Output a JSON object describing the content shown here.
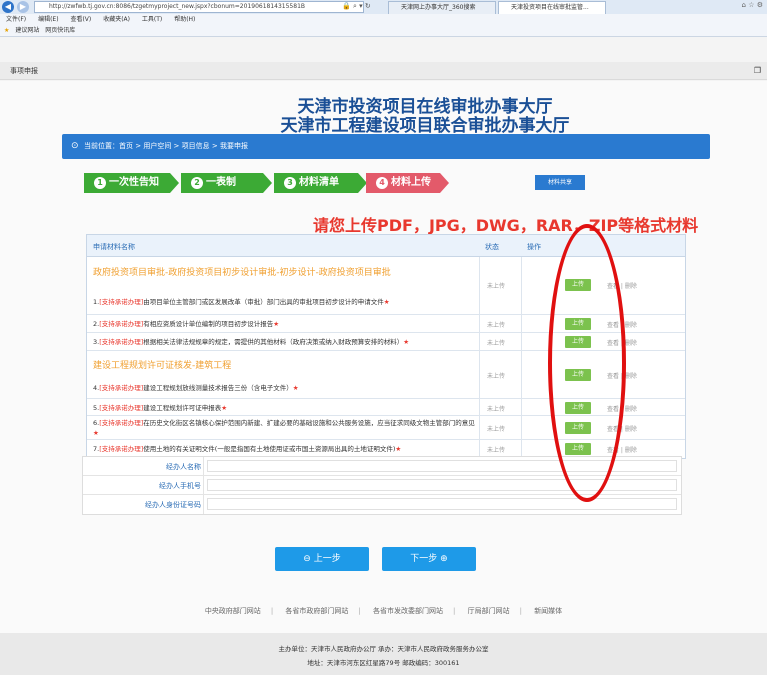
{
  "browser": {
    "address": "http://zwfwb.tj.gov.cn:8086/tzgetmyproject_new.jspx?cbonum=2019061814315581B",
    "tabs": [
      "天津网上办事大厅_360搜索",
      "天津投资项目在线审批监管..."
    ],
    "menu": [
      "文件(F)",
      "编辑(E)",
      "查看(V)",
      "收藏夹(A)",
      "工具(T)",
      "帮助(H)"
    ],
    "favorites": [
      "建议网站",
      "网页快讯库"
    ]
  },
  "page_header": "事项申报",
  "title_line1": "天津市投资项目在线审批办事大厅",
  "title_line2": "天津市工程建设项目联合审批办事大厅",
  "breadcrumb": "当前位置：首页 > 用户空间 > 项目信息 > 我要申报",
  "steps": [
    {
      "num": "1",
      "label": "一次性告知"
    },
    {
      "num": "2",
      "label": "一表制"
    },
    {
      "num": "3",
      "label": "材料清单"
    },
    {
      "num": "4",
      "label": "材料上传"
    }
  ],
  "share_button": "材料共享",
  "notice": "请您上传PDF，JPG，DWG，RAR，ZIP等格式材料",
  "table": {
    "col_name": "申请材料名称",
    "col_status": "状态",
    "col_action": "操作",
    "status_text": "未上传",
    "upload_label": "上传",
    "links_text": "查看 | 删除",
    "group1": "政府投资项目审批-政府投资项目初步设计审批-初步设计-政府投资项目审批",
    "group2": "建设工程规划许可证核发-建筑工程",
    "rows": [
      {
        "prefix": "1.",
        "tag": "[支持承诺办理]",
        "text": "由项目单位主管部门或区发展改革（审批）部门出具的审批项目初步设计的申请文件"
      },
      {
        "prefix": "2.",
        "tag": "[支持承诺办理]",
        "text": "有相应资质设计单位编制的项目初步设计报告"
      },
      {
        "prefix": "3.",
        "tag": "[支持承诺办理]",
        "text": "根据相关法律法规规章的规定，需提供的其他材料（政府决策或纳入财政预算安排的材料）"
      },
      {
        "prefix": "4.",
        "tag": "[支持承诺办理]",
        "text": "建设工程规划放线测量技术报告三份（含电子文件）"
      },
      {
        "prefix": "5.",
        "tag": "[支持承诺办理]",
        "text": "建设工程规划许可证申报表"
      },
      {
        "prefix": "6.",
        "tag": "[支持承诺办理]",
        "text": "在历史文化街区名镇核心保护范围内新建、扩建必要的基础设施和公共服务设施，应当征求同级文物主管部门的意见"
      },
      {
        "prefix": "7.",
        "tag": "[支持承诺办理]",
        "text": "使用土地的有关证明文件(一般是指国有土地使用证或市国土资源局出具的土地证明文件)"
      }
    ]
  },
  "form": {
    "agent_name_label": "经办人名称",
    "agent_phone_label": "经办人手机号",
    "agent_id_label": "经办人身份证号码"
  },
  "prev_button": "上一步",
  "next_button": "下一步",
  "footer_links": [
    "中央政府部门网站",
    "各省市政府部门网站",
    "各省市发改委部门网站",
    "厅局部门网站",
    "新闻媒体"
  ],
  "footer_line1": "主办单位：天津市人民政府办公厅 承办：天津市人民政府政务服务办公室",
  "footer_line2": "地址：天津市河东区红星路79号 邮政编码：300161",
  "annotation_color": "#e01010"
}
